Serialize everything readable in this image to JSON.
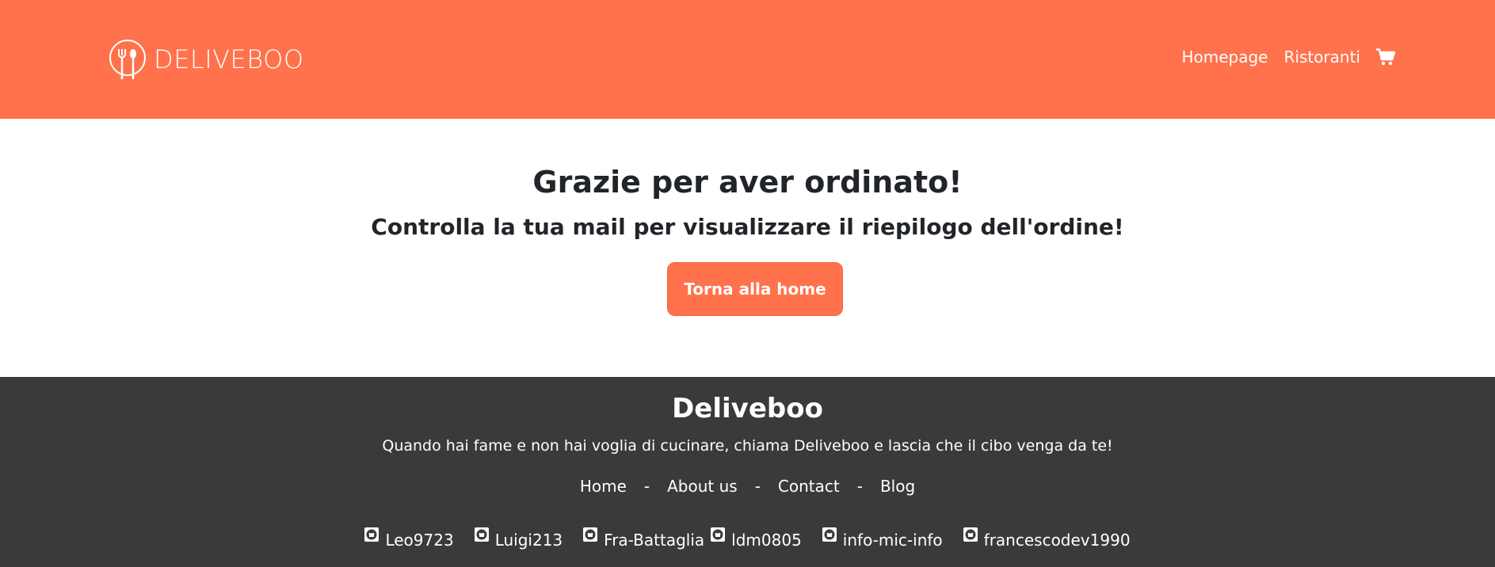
{
  "brand": {
    "name": "DELIVEBOO",
    "accent_color": "#ff724c",
    "logo_icon": "fork-spoon-plate-icon"
  },
  "nav": {
    "items": [
      {
        "label": "Homepage"
      },
      {
        "label": "Ristoranti"
      }
    ],
    "cart_icon": "shopping-cart-icon"
  },
  "main": {
    "title": "Grazie per aver ordinato!",
    "subtitle": "Controlla la tua mail per visualizzare il riepilogo dell'ordine!",
    "button_label": "Torna alla home"
  },
  "footer": {
    "background_color": "#3a3a3a",
    "title": "Deliveboo",
    "tagline": "Quando hai fame e non hai voglia di cucinare, chiama Deliveboo e lascia che il cibo venga da te!",
    "links": [
      {
        "label": "Home"
      },
      {
        "label": "About us"
      },
      {
        "label": "Contact"
      },
      {
        "label": "Blog"
      }
    ],
    "separator": "-",
    "developers": [
      {
        "handle": "Leo9723",
        "icon": "github-icon"
      },
      {
        "handle": "Luigi213",
        "icon": "github-icon"
      },
      {
        "handle": "Fra-Battaglia",
        "icon": "github-icon"
      },
      {
        "handle": "ldm0805",
        "icon": "github-icon"
      },
      {
        "handle": "info-mic-info",
        "icon": "github-icon"
      },
      {
        "handle": "francescodev1990",
        "icon": "github-icon"
      }
    ]
  }
}
